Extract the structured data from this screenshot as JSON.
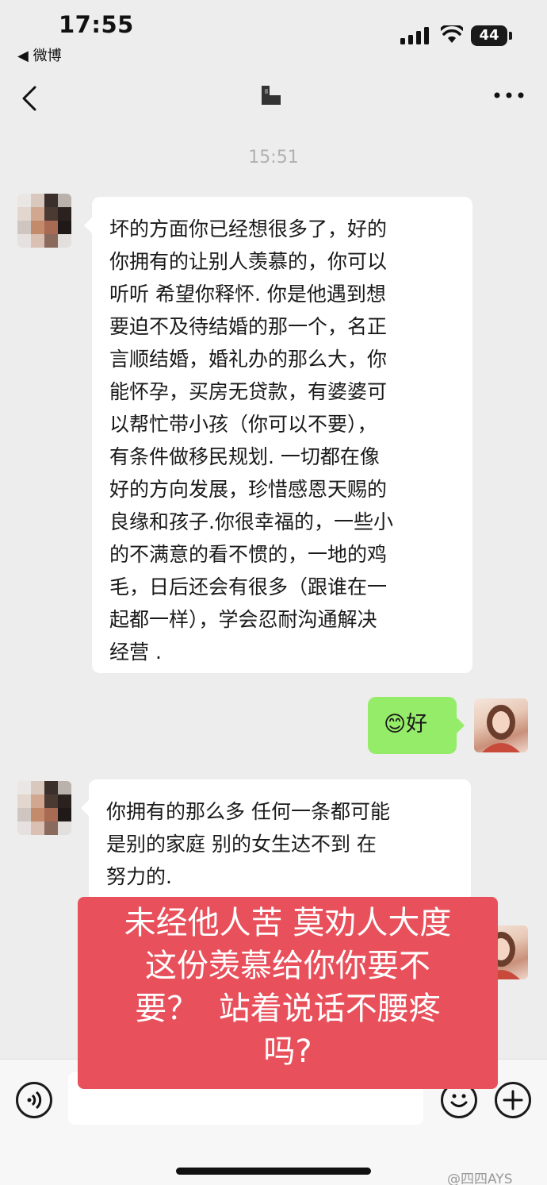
{
  "status": {
    "time": "17:55",
    "back_app": "◀ 微博",
    "battery": "44"
  },
  "chat": {
    "timestamp": "15:51",
    "messages": [
      {
        "sender": "other",
        "text": "坏的方面你已经想很多了，好的\n你拥有的让别人羡慕的，你可以\n听听 希望你释怀. 你是他遇到想\n要迫不及待结婚的那一个，名正\n言顺结婚，婚礼办的那么大，你\n能怀孕，买房无贷款，有婆婆可\n以帮忙带小孩（你可以不要），\n有条件做移民规划. 一切都在像\n好的方向发展，珍惜感恩天赐的\n良缘和孩子.你很幸福的，一些小\n的不满意的看不惯的，一地的鸡\n毛，日后还会有很多（跟谁在一\n起都一样），学会忍耐沟通解决\n经营 ."
      },
      {
        "sender": "me",
        "text": "😊好"
      },
      {
        "sender": "other",
        "text": "你拥有的那么多 任何一条都可能\n是别的家庭 别的女生达不到 在\n努力的."
      }
    ]
  },
  "overlay": {
    "text": "未经他人苦 莫劝人大度\n这份羡慕给你你要不\n要？  站着说话不腰疼\n吗?"
  },
  "footer": {
    "watermark": "@四四AYS"
  },
  "colors": {
    "background": "#ededed",
    "my_bubble": "#95ec69",
    "overlay": "#e8505b"
  }
}
